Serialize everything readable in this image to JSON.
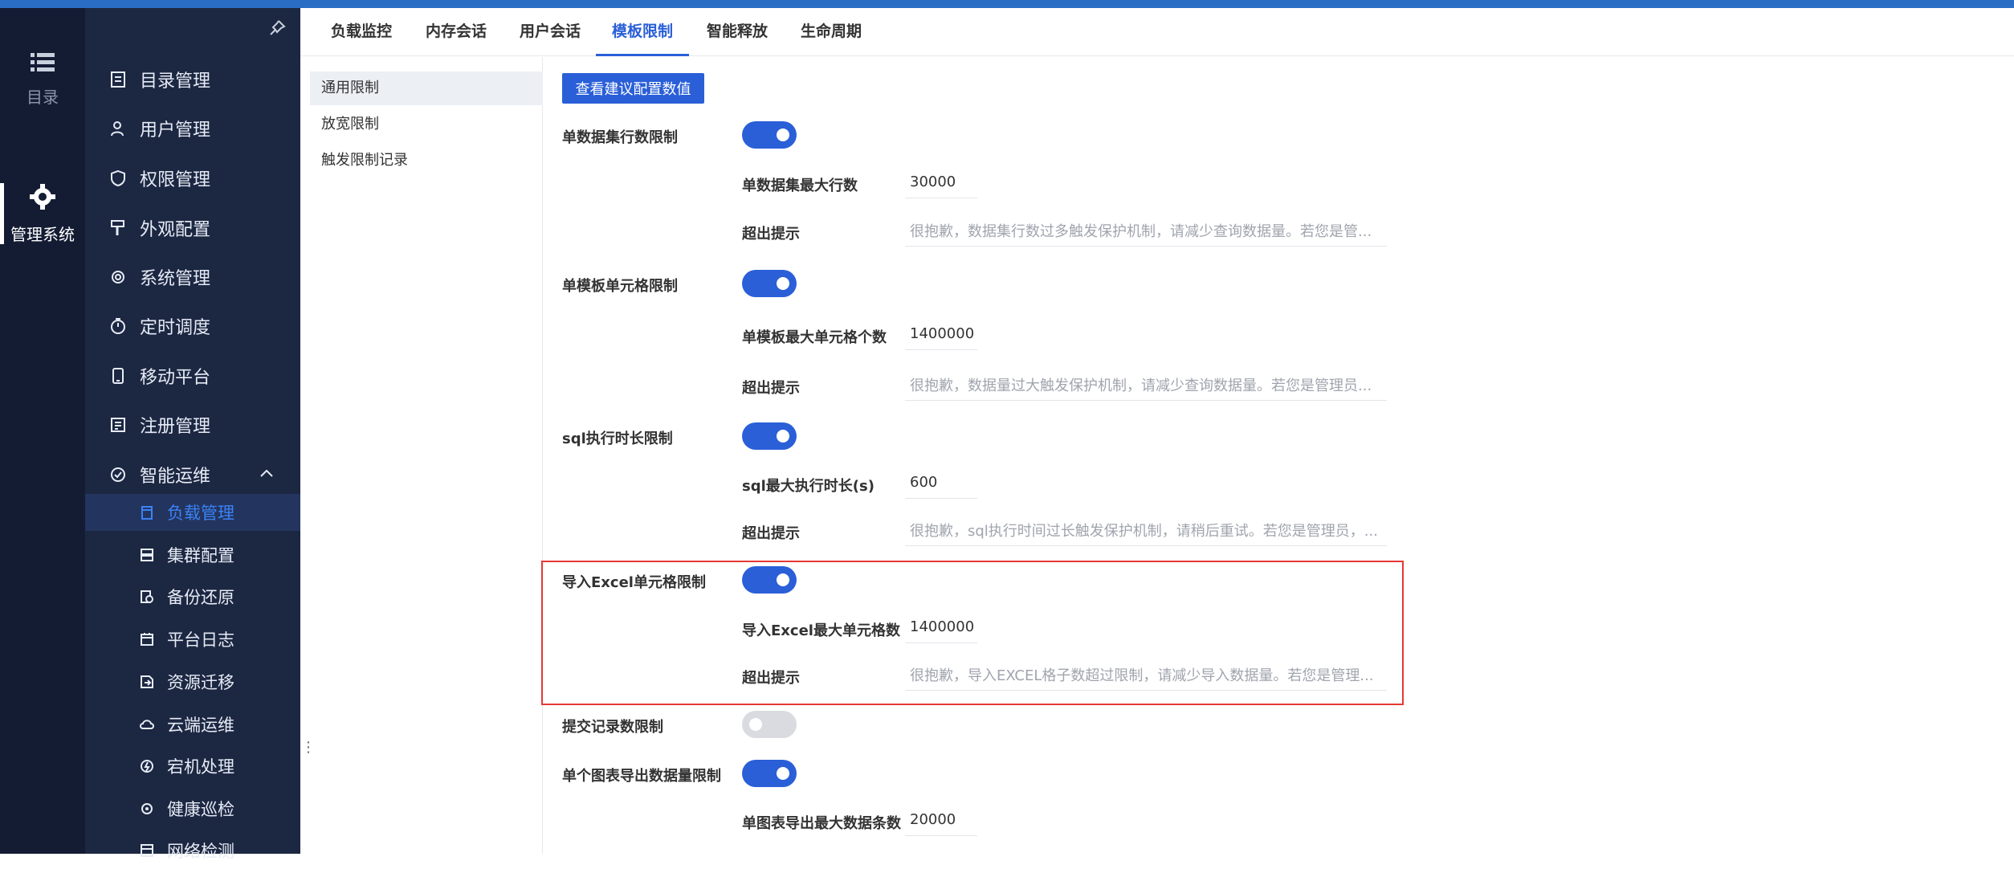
{
  "rail": {
    "items": [
      {
        "label": "目录",
        "icon": "list-icon"
      },
      {
        "label": "管理系统",
        "icon": "gear-icon",
        "active": true
      }
    ]
  },
  "nav": {
    "items": [
      {
        "label": "目录管理",
        "icon": "catalog-icon"
      },
      {
        "label": "用户管理",
        "icon": "user-icon"
      },
      {
        "label": "权限管理",
        "icon": "shield-icon"
      },
      {
        "label": "外观配置",
        "icon": "brush-icon"
      },
      {
        "label": "系统管理",
        "icon": "settings-icon"
      },
      {
        "label": "定时调度",
        "icon": "timer-icon"
      },
      {
        "label": "移动平台",
        "icon": "mobile-icon"
      },
      {
        "label": "注册管理",
        "icon": "register-icon"
      },
      {
        "label": "智能运维",
        "icon": "ops-icon",
        "expanded": true
      }
    ],
    "sub_items": [
      {
        "label": "负载管理",
        "icon": "load-icon",
        "selected": true
      },
      {
        "label": "集群配置",
        "icon": "cluster-icon"
      },
      {
        "label": "备份还原",
        "icon": "backup-icon"
      },
      {
        "label": "平台日志",
        "icon": "log-icon"
      },
      {
        "label": "资源迁移",
        "icon": "migrate-icon"
      },
      {
        "label": "云端运维",
        "icon": "cloud-icon"
      },
      {
        "label": "宕机处理",
        "icon": "crash-icon"
      },
      {
        "label": "健康巡检",
        "icon": "health-icon"
      },
      {
        "label": "网络检测",
        "icon": "network-icon"
      }
    ]
  },
  "tabs": [
    "负载监控",
    "内存会话",
    "用户会话",
    "模板限制",
    "智能释放",
    "生命周期"
  ],
  "active_tab": "模板限制",
  "submenu": [
    "通用限制",
    "放宽限制",
    "触发限制记录"
  ],
  "content": {
    "view_button": "查看建议配置数值",
    "sections": [
      {
        "label": "单数据集行数限制",
        "enabled": true,
        "fields": [
          {
            "label": "单数据集最大行数",
            "value": "30000"
          },
          {
            "label": "超出提示",
            "value": "很抱歉，数据集行数过多触发保护机制，请减少查询数据量。若您是管..."
          }
        ]
      },
      {
        "label": "单模板单元格限制",
        "enabled": true,
        "fields": [
          {
            "label": "单模板最大单元格个数",
            "value": "1400000"
          },
          {
            "label": "超出提示",
            "value": "很抱歉，数据量过大触发保护机制，请减少查询数据量。若您是管理员..."
          }
        ]
      },
      {
        "label": "sql执行时长限制",
        "enabled": true,
        "fields": [
          {
            "label": "sql最大执行时长(s)",
            "value": "600"
          },
          {
            "label": "超出提示",
            "value": "很抱歉，sql执行时间过长触发保护机制，请稍后重试。若您是管理员，..."
          }
        ]
      },
      {
        "label": "导入Excel单元格限制",
        "enabled": true,
        "fields": [
          {
            "label": "导入Excel最大单元格数",
            "value": "1400000"
          },
          {
            "label": "超出提示",
            "value": "很抱歉，导入EXCEL格子数超过限制，请减少导入数据量。若您是管理..."
          }
        ]
      },
      {
        "label": "提交记录数限制",
        "enabled": false,
        "fields": []
      },
      {
        "label": "单个图表导出数据量限制",
        "enabled": true,
        "fields": [
          {
            "label": "单图表导出最大数据条数",
            "value": "20000"
          }
        ]
      }
    ]
  },
  "colors": {
    "accent": "#2a5fd8",
    "rail_bg": "#131c33",
    "nav_bg": "#1c2742",
    "highlight": "#e53935"
  }
}
